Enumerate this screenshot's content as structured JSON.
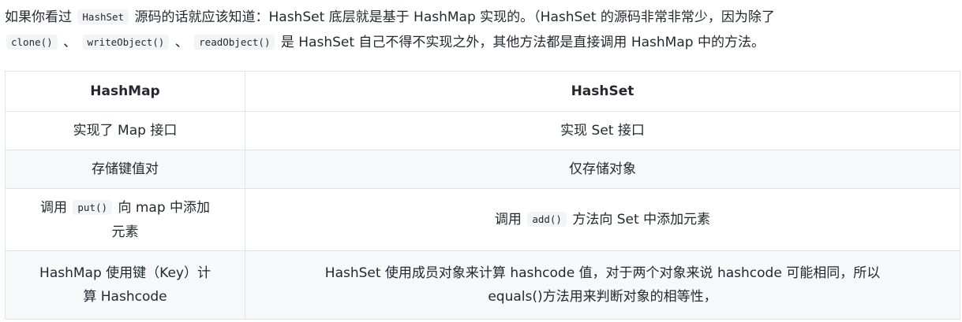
{
  "intro": {
    "line1_a": "如果你看过",
    "line1_code": "HashSet",
    "line1_b": "源码的话就应该知道：HashSet 底层就是基于 HashMap 实现的。（HashSet 的源码非常非常少，因为除了",
    "line2_code1": "clone()",
    "line2_sep1": "、",
    "line2_code2": "writeObject()",
    "line2_sep2": "、",
    "line2_code3": "readObject()",
    "line2_b": "是 HashSet 自己不得不实现之外，其他方法都是直接调用 HashMap 中的方法。"
  },
  "table": {
    "headers": [
      "HashMap",
      "HashSet"
    ],
    "rows": [
      {
        "left": "实现了 Map 接口",
        "right": "实现 Set 接口"
      },
      {
        "left": "存储键值对",
        "right": "仅存储对象"
      },
      {
        "left_a": "调用",
        "left_code": "put()",
        "left_b": "向 map 中添加",
        "left_c": "元素",
        "right_a": "调用",
        "right_code": "add()",
        "right_b": "方法向 Set 中添加元素"
      },
      {
        "left_line1": "HashMap 使用键（Key）计",
        "left_line2": "算 Hashcode",
        "right_line1": "HashSet 使用成员对象来计算 hashcode 值，对于两个对象来说 hashcode 可能相同，所以",
        "right_line2": "equals()方法用来判断对象的相等性，"
      }
    ]
  }
}
